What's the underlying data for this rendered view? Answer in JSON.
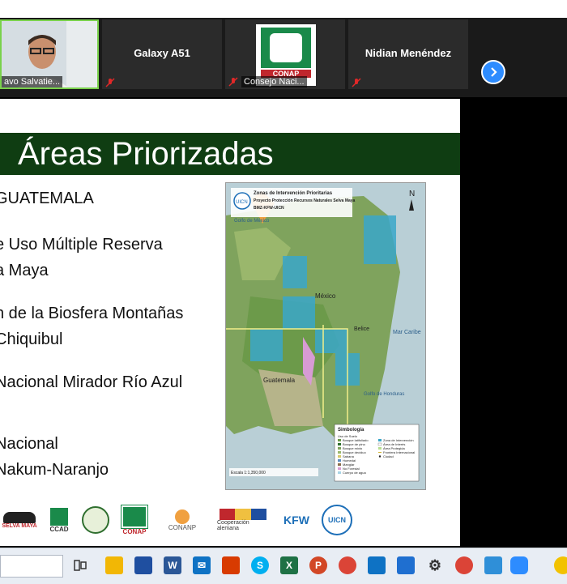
{
  "participants": {
    "tile1": {
      "name": "avo Salvatie..."
    },
    "tile2": {
      "name": "Galaxy A51"
    },
    "tile3": {
      "name": "Consejo Naci...",
      "logo_text": "CONAP"
    },
    "tile4": {
      "name": "Nidian Menéndez"
    },
    "next_icon": "chevron-right-icon"
  },
  "slide": {
    "title": "Áreas Priorizadas",
    "bullets": [
      "GUATEMALA",
      "e Uso Múltiple Reserva",
      "a Maya",
      "n de la Biosfera Montañas",
      "Chiquibul",
      "Nacional Mirador Río Azul",
      "Nacional",
      "Nakum-Naranjo"
    ],
    "map": {
      "header_line1": "Zonas de Intervención Prioritarias",
      "header_line2": "Proyecto Protección Recursos Naturales Selva Maya",
      "header_line3": "BMZ-KFW-UICN",
      "badge": "UICN",
      "labels": [
        "Golfo de México",
        "México",
        "Belice",
        "Guatemala",
        "Mar Caribe",
        "Golfo de Honduras"
      ],
      "legend_title": "Simbología",
      "legend_items": [
        "Uso de Suelo",
        "Bosque latifoliado",
        "Bosque de pino",
        "Bosque mixto",
        "Bosque deciduo",
        "Sabana",
        "Humedal",
        "Manglar",
        "No Forestal",
        "Cuerpo de agua",
        "Zona de Intervención",
        "Área de Interés",
        "Área Protegida",
        "Frontera Internacional",
        "Ciudad"
      ],
      "scale": "Escala 1:1,350,000"
    },
    "logos": [
      "SELVA MAYA",
      "CCAD",
      "",
      "CONAP",
      "CONANP",
      "Cooperación alemana",
      "KFW",
      "UICN"
    ]
  },
  "taskbar": {
    "icons": [
      "task-view-icon",
      "file-explorer-icon",
      "store-icon",
      "word-icon",
      "mail-icon",
      "office-icon",
      "skype-icon",
      "excel-icon",
      "powerpoint-icon",
      "chrome-icon",
      "onedrive-icon",
      "calendar-icon",
      "settings-icon",
      "chrome-icon",
      "photos-icon",
      "zoom-icon"
    ]
  },
  "colors": {
    "title_bar": "#0f3d12",
    "active_speaker_border": "#7ad24c",
    "zoom_blue": "#2d8cff",
    "mic_off_red": "#e02828"
  }
}
